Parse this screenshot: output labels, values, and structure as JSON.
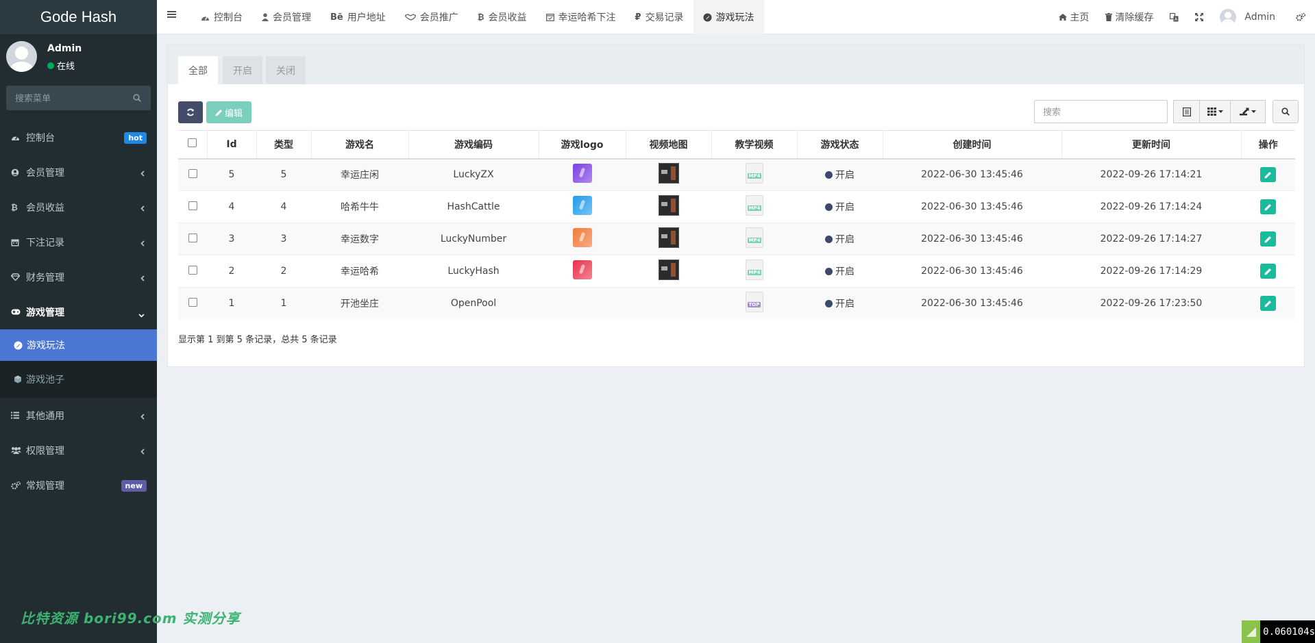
{
  "app": {
    "title": "Gode Hash"
  },
  "user": {
    "name": "Admin",
    "status": "在线"
  },
  "sidebar": {
    "search_placeholder": "搜索菜单",
    "items": [
      {
        "label": "控制台",
        "icon": "dashboard-icon",
        "badge": "hot"
      },
      {
        "label": "会员管理",
        "icon": "user-circle-icon"
      },
      {
        "label": "会员收益",
        "icon": "bitcoin-icon"
      },
      {
        "label": "下注记录",
        "icon": "calendar-icon"
      },
      {
        "label": "财务管理",
        "icon": "diamond-icon"
      },
      {
        "label": "游戏管理",
        "icon": "gamepad-icon"
      },
      {
        "label": "其他通用",
        "icon": "list-icon"
      },
      {
        "label": "权限管理",
        "icon": "users-icon"
      },
      {
        "label": "常规管理",
        "icon": "cogs-icon",
        "badge": "new"
      }
    ],
    "subitems": [
      {
        "label": "游戏玩法",
        "icon": "rocket-icon",
        "active": true
      },
      {
        "label": "游戏池子",
        "icon": "cube-icon",
        "active": false
      }
    ],
    "watermark": "比特资源 bori99.com 实测分享"
  },
  "header": {
    "tabs": [
      {
        "label": "控制台",
        "icon": "dashboard-icon"
      },
      {
        "label": "会员管理",
        "icon": "user-icon"
      },
      {
        "label": "用户地址",
        "icon": "behance-icon"
      },
      {
        "label": "会员推广",
        "icon": "handshake-icon"
      },
      {
        "label": "会员收益",
        "icon": "bitcoin-icon"
      },
      {
        "label": "幸运哈希下注",
        "icon": "calendar-check-icon"
      },
      {
        "label": "交易记录",
        "icon": "ruble-icon"
      },
      {
        "label": "游戏玩法",
        "icon": "rocket-icon",
        "active": true
      }
    ],
    "right": {
      "home": "主页",
      "clear_cache": "清除缓存",
      "admin": "Admin"
    }
  },
  "panel": {
    "tabs": [
      "全部",
      "开启",
      "关闭"
    ],
    "edit_label": "编辑",
    "search_placeholder": "搜索",
    "summary": "显示第 1 到第 5 条记录，总共 5 条记录"
  },
  "table": {
    "columns": [
      "Id",
      "类型",
      "游戏名",
      "游戏编码",
      "游戏logo",
      "视频地图",
      "教学视频",
      "游戏状态",
      "创建时间",
      "更新时间",
      "操作"
    ],
    "rows": [
      {
        "id": "5",
        "type": "5",
        "name": "幸运庄闲",
        "code": "LuckyZX",
        "logo_color": "#7b3fe4",
        "has_logo": true,
        "video_type": "MP4",
        "status": "开启",
        "created": "2022-06-30 13:45:46",
        "updated": "2022-09-26 17:14:21"
      },
      {
        "id": "4",
        "type": "4",
        "name": "哈希牛牛",
        "code": "HashCattle",
        "logo_color": "#1e9be8",
        "has_logo": true,
        "video_type": "MP4",
        "status": "开启",
        "created": "2022-06-30 13:45:46",
        "updated": "2022-09-26 17:14:24"
      },
      {
        "id": "3",
        "type": "3",
        "name": "幸运数字",
        "code": "LuckyNumber",
        "logo_color": "#f07a3a",
        "has_logo": true,
        "video_type": "MP4",
        "status": "开启",
        "created": "2022-06-30 13:45:46",
        "updated": "2022-09-26 17:14:27"
      },
      {
        "id": "2",
        "type": "2",
        "name": "幸运哈希",
        "code": "LuckyHash",
        "logo_color": "#e8304a",
        "has_logo": true,
        "video_type": "MP4",
        "status": "开启",
        "created": "2022-06-30 13:45:46",
        "updated": "2022-09-26 17:14:29"
      },
      {
        "id": "1",
        "type": "1",
        "name": "开池坐庄",
        "code": "OpenPool",
        "logo_color": "",
        "has_logo": false,
        "video_type": "TOP",
        "status": "开启",
        "created": "2022-06-30 13:45:46",
        "updated": "2022-09-26 17:23:50"
      }
    ]
  },
  "footer": {
    "timer": "0.060104s"
  },
  "colors": {
    "sidebar_bg": "#222d32",
    "active_menu": "#4a77d4",
    "status_dot": "#3b4a6b",
    "edit_btn": "#18bc9c",
    "mp4_tag": "#7dd3b0",
    "top_tag": "#a78bd8"
  }
}
